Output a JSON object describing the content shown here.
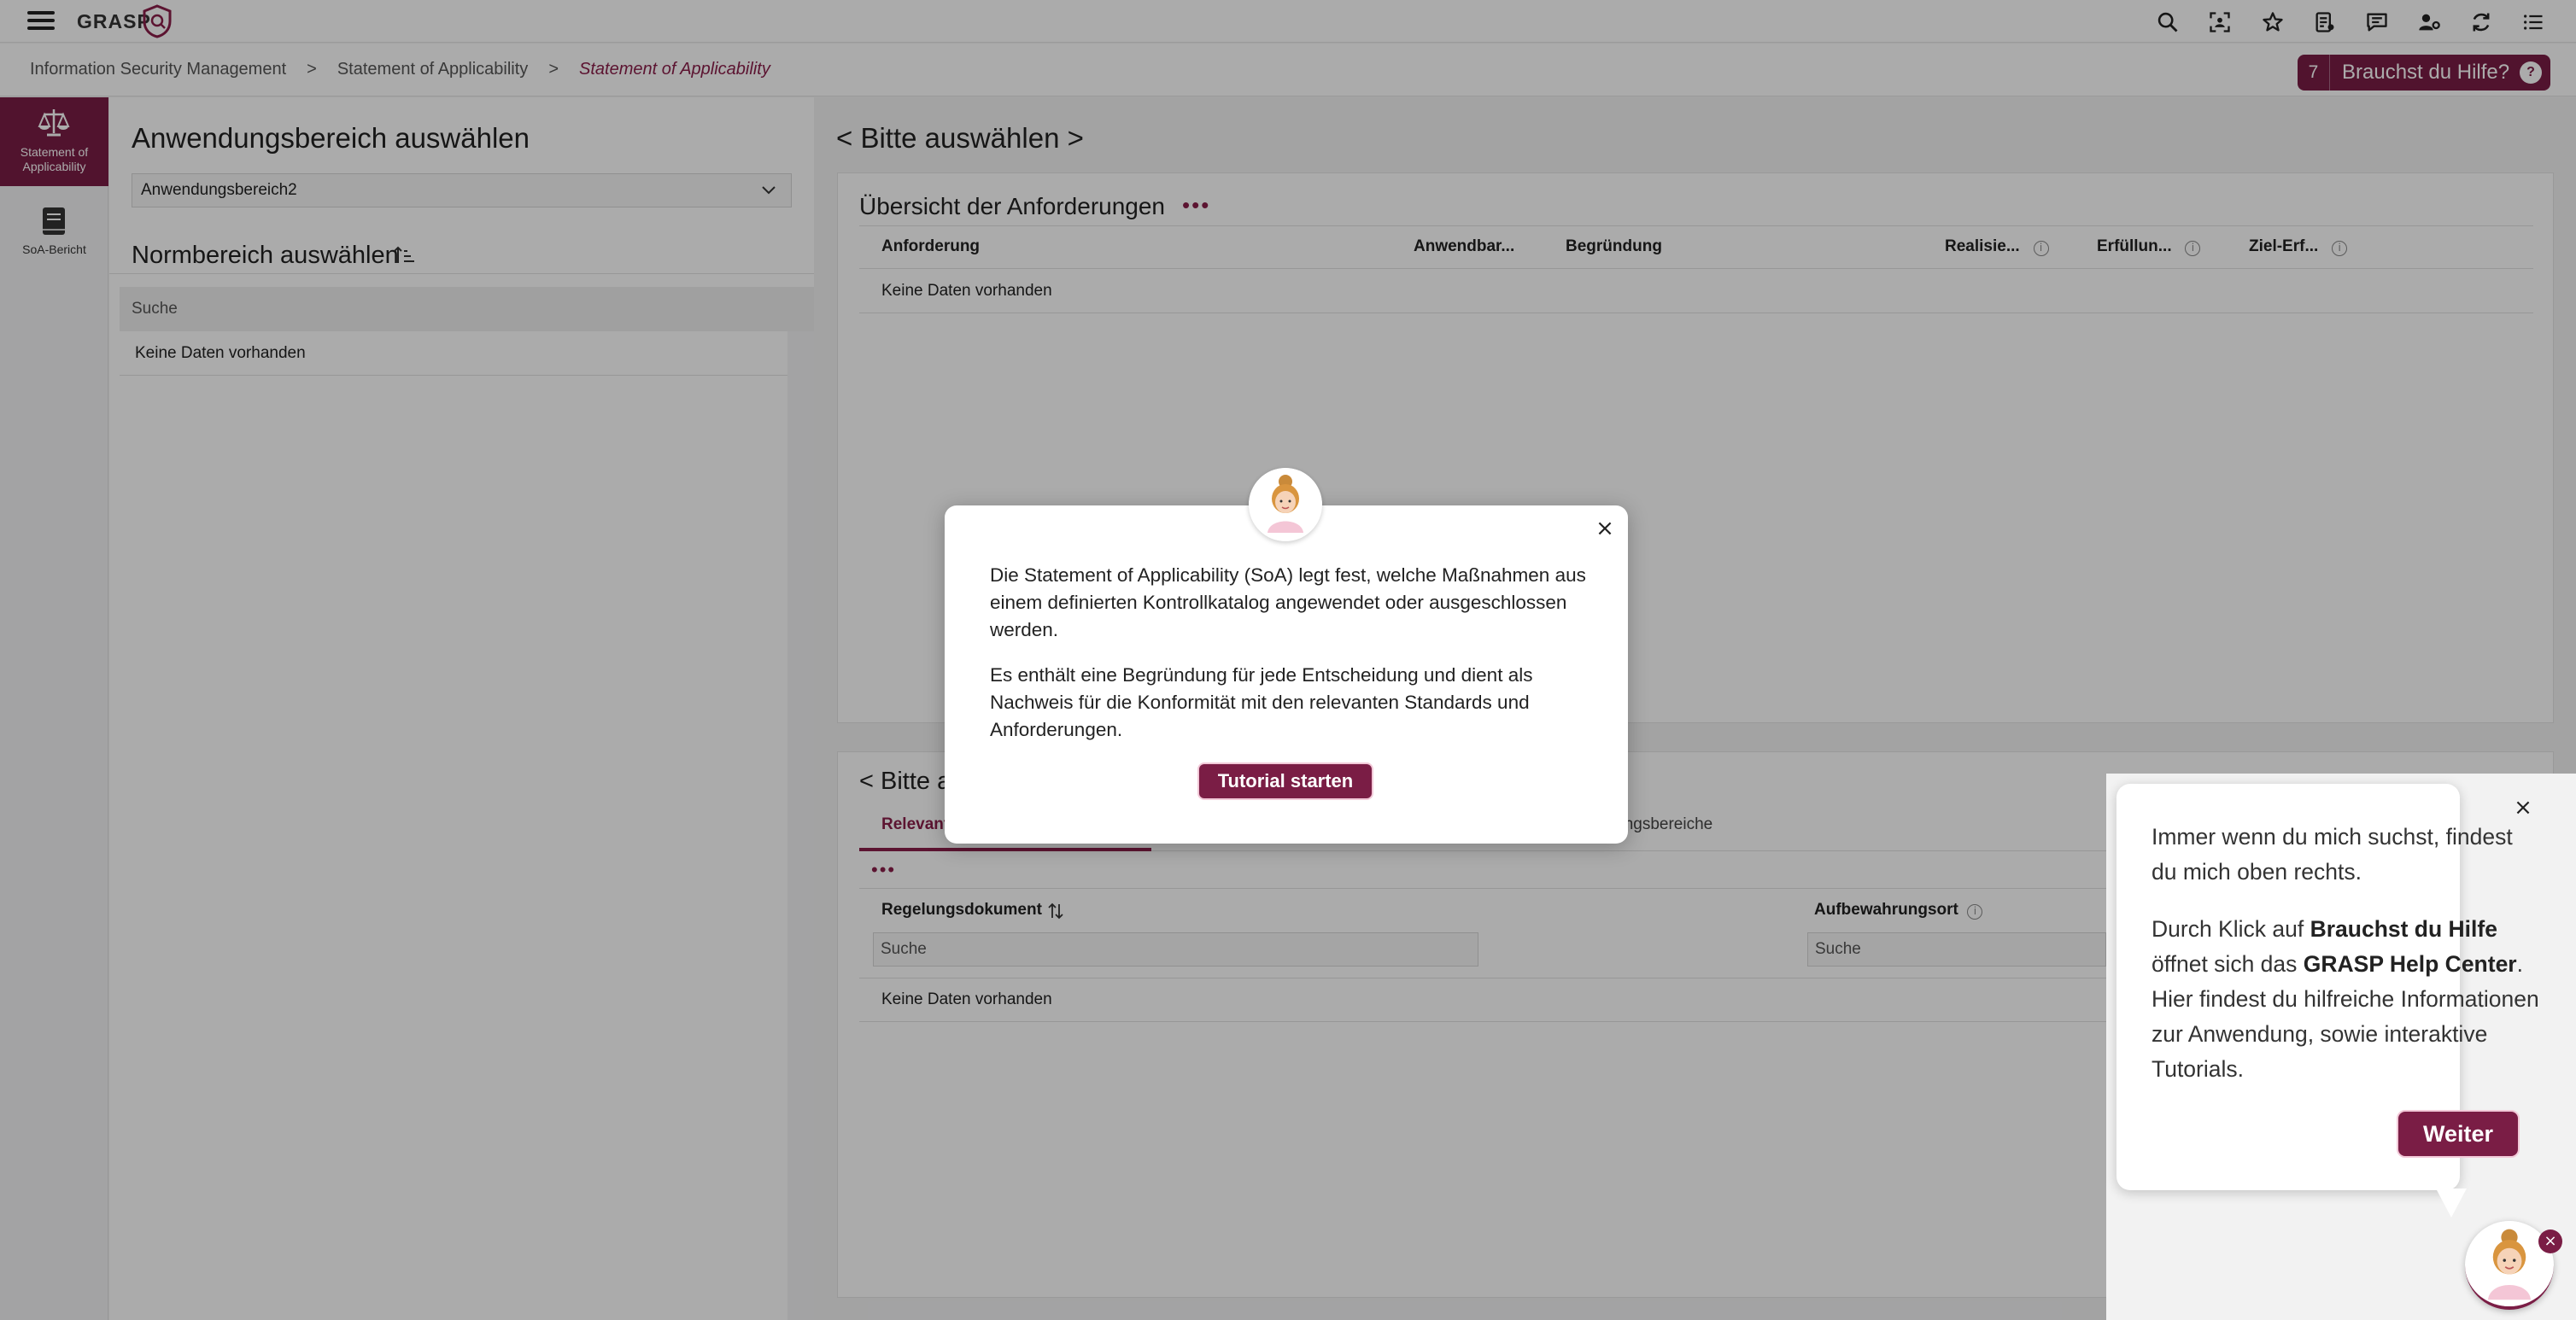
{
  "app": {
    "logo_text": "GRASP"
  },
  "breadcrumb": {
    "items": [
      "Information Security Management",
      "Statement of Applicability"
    ],
    "separator": ">",
    "current": "Statement of Applicability"
  },
  "help_button": {
    "count": "7",
    "label": "Brauchst du Hilfe?"
  },
  "toolbar_icons": [
    "search-icon",
    "scan-icon",
    "star-icon",
    "document-icon",
    "chat-icon",
    "user-settings-icon",
    "refresh-icon",
    "list-icon"
  ],
  "leftnav": {
    "items": [
      {
        "label": "Statement of Applicability",
        "icon": "scale-icon",
        "active": true
      },
      {
        "label": "SoA-Bericht",
        "icon": "book-icon",
        "active": false
      }
    ]
  },
  "left_panel": {
    "title": "Anwendungsbereich auswählen",
    "scope_value": "Anwendungsbereich2",
    "norm_title": "Normbereich auswählen",
    "norm_search_placeholder": "Suche",
    "norm_empty": "Keine Daten vorhanden"
  },
  "right_panel": {
    "title": "< Bitte auswählen >",
    "card1": {
      "title": "Übersicht der Anforderungen",
      "dots": "•••",
      "columns": [
        "Anforderung",
        "Anwendbar...",
        "Begründung",
        "Realisie...",
        "Erfüllun...",
        "Ziel-Erf..."
      ],
      "info_mark": "i",
      "empty": "Keine Daten vorhanden"
    },
    "card2": {
      "title": "< Bitte a",
      "tabs": [
        "Relevant",
        "ndungsbereiche"
      ],
      "dots": "•••",
      "columns": [
        "Regelungsdokument",
        "Aufbewahrungsort"
      ],
      "search_placeholder": "Suche",
      "empty": "Keine Daten vorhanden"
    }
  },
  "modal": {
    "paragraph1": "Die Statement of Applicability (SoA) legt fest, welche Maßnahmen aus einem definierten Kontrollkatalog angewendet oder ausgeschlossen werden.",
    "paragraph2": "Es enthält eine Begründung für jede Entscheidung und dient als Nachweis für die Konformität mit den relevanten Standards und Anforderungen.",
    "button": "Tutorial starten",
    "close": "×"
  },
  "help_bubble": {
    "paragraph1": "Immer wenn du mich suchst, findest du mich oben rechts.",
    "p2_part1": "Durch Klick auf ",
    "p2_bold1": "Brauchst du Hilfe",
    "p2_part2": " öffnet sich das ",
    "p2_bold2": "GRASP Help Center",
    "p2_part3": ". Hier findest du hilfreiche Informationen zur Anwendung, sowie interaktive Tutorials.",
    "button": "Weiter",
    "close": "×",
    "badge": "×"
  },
  "colors": {
    "accent": "#7a1d45",
    "accent_text": "#8a1f4a"
  }
}
